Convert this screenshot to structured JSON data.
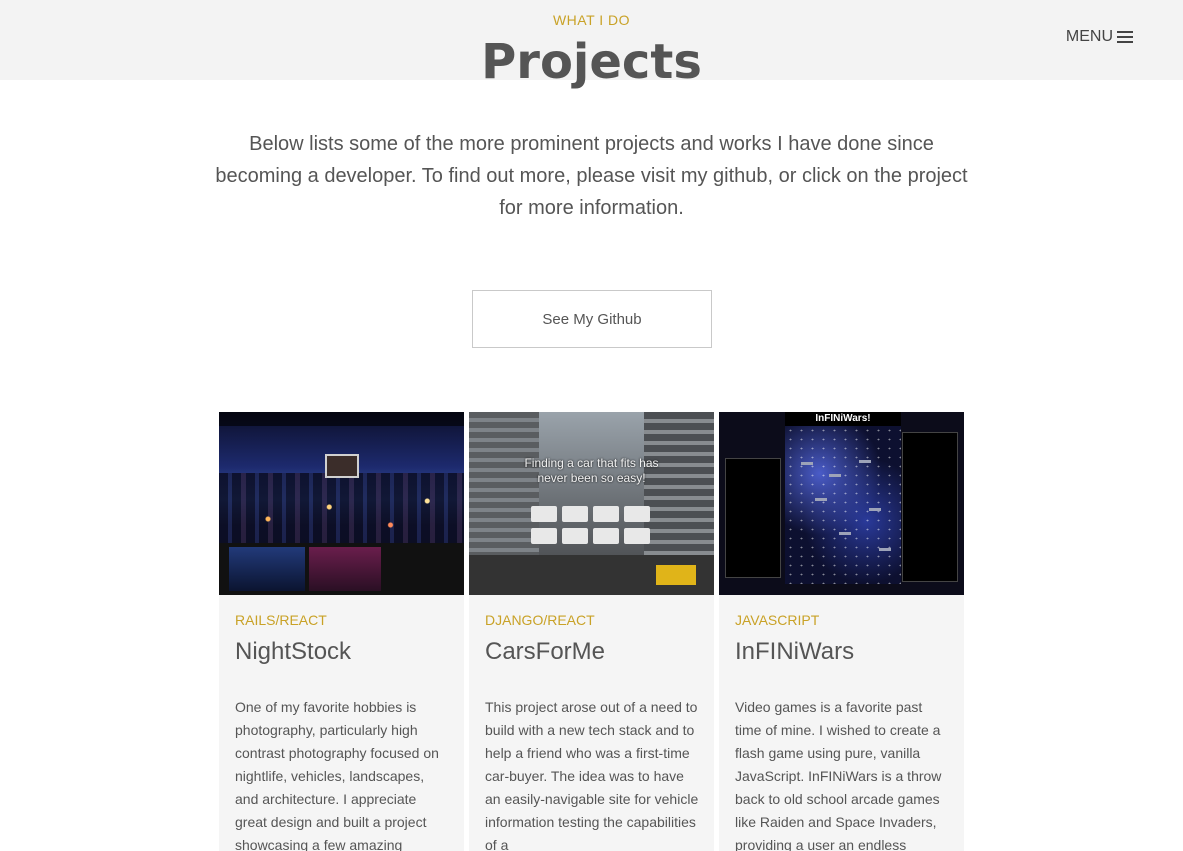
{
  "nav": {
    "menu_label": "MENU"
  },
  "header": {
    "eyebrow": "WHAT I DO",
    "title": "Projects"
  },
  "intro": "Below lists some of the more prominent projects and works I have done since becoming a developer. To find out more, please visit my github, or click on the project for more information.",
  "github_button": "See My Github",
  "projects": [
    {
      "tag": "RAILS/REACT",
      "title": "NightStock",
      "description": "One of my favorite hobbies is photography, particularly high contrast photography focused on nightlife, vehicles, landscapes, and architecture. I appreciate great design and built a project showcasing a few amazing"
    },
    {
      "tag": "DJANGO/REACT",
      "title": "CarsForMe",
      "description": "This project arose out of a need to build with a new tech stack and to help a friend who was a first-time car-buyer. The idea was to have an easily-navigable site for vehicle information testing the capabilities of a",
      "thumb_text": "Finding a car that fits has never been so easy!"
    },
    {
      "tag": "JAVASCRIPT",
      "title": "InFINiWars",
      "description": "Video games is a favorite past time of mine. I wished to create a flash game using pure, vanilla JavaScript. InFINiWars is a throw back to old school arcade games like Raiden and Space Invaders, providing a user an endless",
      "thumb_text": "InFINiWars!"
    }
  ],
  "colors": {
    "accent": "#c9a227",
    "text": "#555555",
    "card_bg": "#f5f5f5"
  }
}
